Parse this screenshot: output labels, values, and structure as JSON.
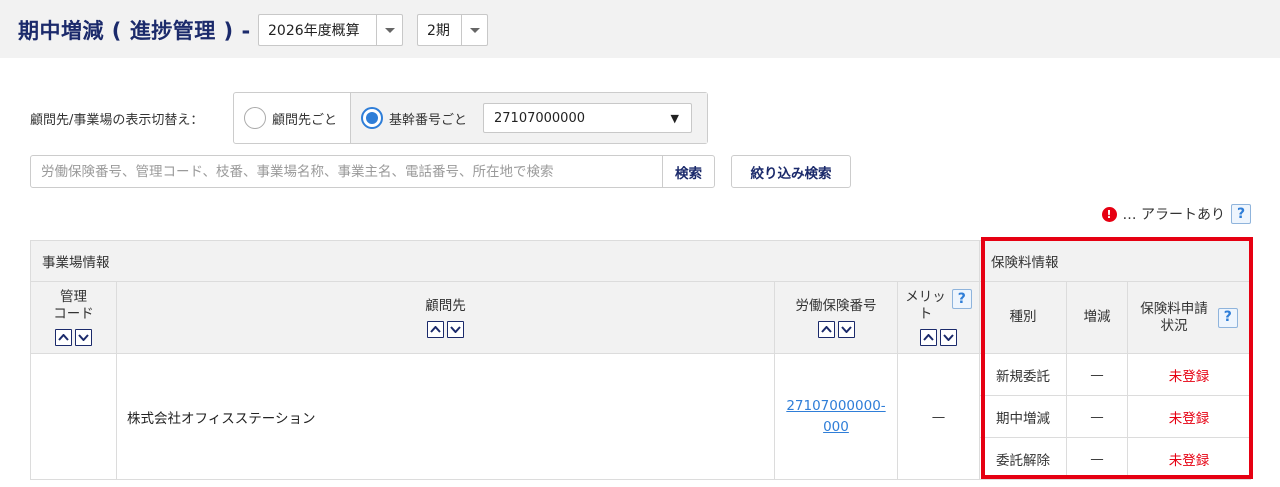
{
  "header": {
    "title": "期中増減 ( 進捗管理 ) -",
    "fiscal_year": "2026年度概算",
    "period": "2期"
  },
  "filter": {
    "display_label": "顧問先/事業場の表示切替え：",
    "radio_client": "顧問先ごと",
    "radio_base": "基幹番号ごと",
    "base_number": "27107000000",
    "search_placeholder": "労働保険番号、管理コード、枝番、事業場名称、事業主名、電話番号、所在地で検索",
    "search_button": "検索",
    "narrow_button": "絞り込み検索"
  },
  "legend": {
    "alert_text": "… アラートあり",
    "alert_icon": "!",
    "help": "?"
  },
  "table": {
    "group_site": "事業場情報",
    "group_premium": "保険料情報",
    "col_code": "管理\nコード",
    "col_client": "顧問先",
    "col_insurance_no": "労働保険番号",
    "col_merit": "メリッ\nト",
    "col_kind": "種別",
    "col_change": "増減",
    "col_status": "保険料申請\n状況",
    "help": "?",
    "row": {
      "code": "",
      "client": "株式会社オフィスステーション",
      "insurance_no": "27107000000-\n000",
      "merit": "—",
      "sub_rows": [
        {
          "kind": "新規委託",
          "change": "—",
          "status": "未登録"
        },
        {
          "kind": "期中増減",
          "change": "—",
          "status": "未登録"
        },
        {
          "kind": "委託解除",
          "change": "—",
          "status": "未登録"
        }
      ]
    }
  },
  "colors": {
    "title": "#1b2a6b",
    "link": "#2f7ed8",
    "alert": "#e60012",
    "highlight_border": "#e60012"
  }
}
